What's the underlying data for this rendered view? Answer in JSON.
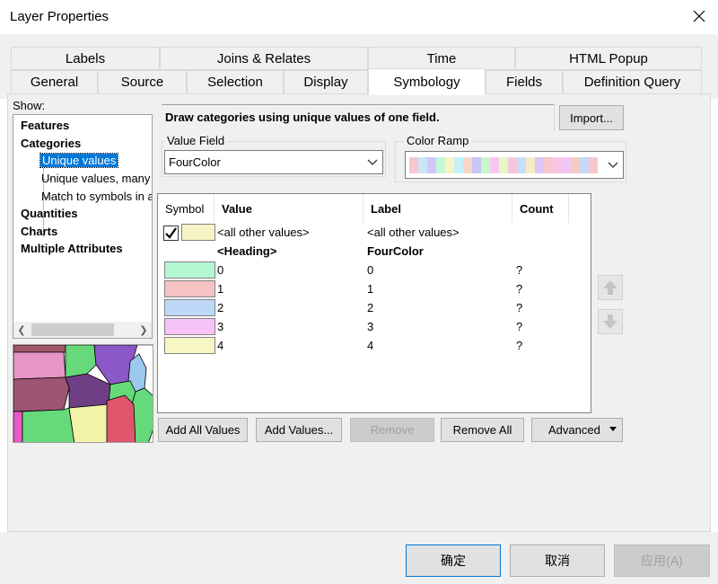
{
  "window": {
    "title": "Layer Properties"
  },
  "tabs": {
    "row_top": [
      "Labels",
      "Joins & Relates",
      "Time",
      "HTML Popup"
    ],
    "row_bottom": [
      "General",
      "Source",
      "Selection",
      "Display",
      "Symbology",
      "Fields",
      "Definition Query"
    ]
  },
  "show": {
    "label": "Show:",
    "items": [
      "Features",
      "Categories",
      "Unique values",
      "Unique values, many",
      "Match to symbols in a",
      "Quantities",
      "Charts",
      "Multiple Attributes"
    ],
    "selected": "Unique values"
  },
  "description": "Draw categories using unique values of one field.",
  "import_label": "Import...",
  "value_field": {
    "label": "Value Field",
    "value": "FourColor"
  },
  "color_ramp": {
    "label": "Color Ramp",
    "colors": [
      "#f7c6ce",
      "#c9e6f7",
      "#d3c6f7",
      "#c6f7d6",
      "#f7f4c6",
      "#c6f2f7",
      "#f7d6c6",
      "#c6c6f7",
      "#c6f7c9",
      "#f7c6f2",
      "#e6f7c6",
      "#f7c6dc",
      "#c6e0f7",
      "#f7eac6",
      "#dcc6f7",
      "#f7c6d0",
      "#f7c6e6",
      "#f0c6f7",
      "#f7c9c6",
      "#c6d8f7",
      "#f7c6cc"
    ]
  },
  "grid": {
    "headers": [
      "Symbol",
      "Value",
      "Label",
      "Count"
    ],
    "other_row": {
      "swatch": "#f7f3c6",
      "value": "<all other values>",
      "label": "<all other values>"
    },
    "heading_row": {
      "value": "<Heading>",
      "label": "FourColor"
    },
    "rows": [
      {
        "color": "#b3f7d3",
        "value": "0",
        "label": "0",
        "count": "?"
      },
      {
        "color": "#f7c2c2",
        "value": "1",
        "label": "1",
        "count": "?"
      },
      {
        "color": "#bed9f7",
        "value": "2",
        "label": "2",
        "count": "?"
      },
      {
        "color": "#f7c2f7",
        "value": "3",
        "label": "3",
        "count": "?"
      },
      {
        "color": "#f7f7c6",
        "value": "4",
        "label": "4",
        "count": "?"
      }
    ]
  },
  "buttons": {
    "add_all": "Add All Values",
    "add": "Add Values...",
    "remove": "Remove",
    "remove_all": "Remove All",
    "advanced": "Advanced"
  },
  "footer": {
    "ok": "确定",
    "cancel": "取消",
    "apply": "应用(A)"
  },
  "icons": {
    "close": "close-icon",
    "check": "check-icon",
    "up": "arrow-up-icon",
    "down": "arrow-down-icon",
    "dropdown": "chevron-down-icon"
  }
}
